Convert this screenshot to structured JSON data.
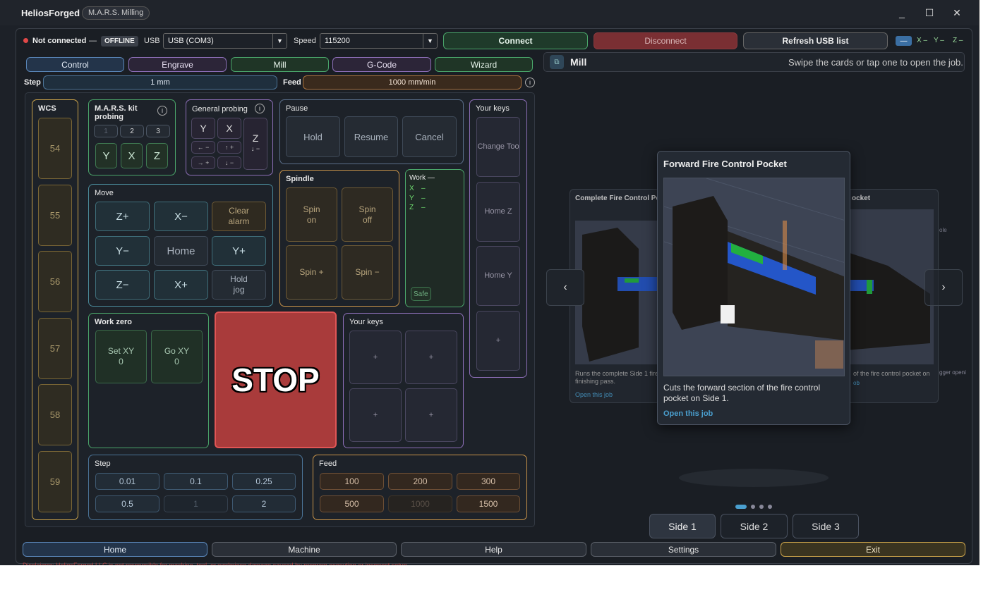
{
  "window": {
    "title": "HeliosForged",
    "badge": "M.A.R.S. Milling",
    "minimize": "_",
    "maximize": "☐",
    "close": "✕"
  },
  "connection": {
    "status": "Not connected",
    "dash": "—",
    "badge": "OFFLINE",
    "usb_label": "USB",
    "usb_value": "USB (COM3)",
    "speed_label": "Speed",
    "speed_value": "115200",
    "connect": "Connect",
    "disconnect": "Disconnect",
    "refresh": "Refresh USB list",
    "mini_btn": "—",
    "x": "X –",
    "y": "Y –",
    "z": "Z –"
  },
  "tabs": [
    "Control",
    "Engrave",
    "Mill",
    "G-Code",
    "Wizard"
  ],
  "step_bar": {
    "label": "Step",
    "value": "1 mm",
    "feed_label": "Feed",
    "feed_value": "1000 mm/min",
    "info": "i"
  },
  "wcs": {
    "title": "WCS",
    "items": [
      "54",
      "55",
      "56",
      "57",
      "58",
      "59"
    ]
  },
  "mars": {
    "title": "M.A.R.S. kit probing",
    "info": "i",
    "nums": [
      "1",
      "2",
      "3"
    ],
    "axes": [
      "Y",
      "X",
      "Z"
    ]
  },
  "general_probing": {
    "title": "General probing",
    "info": "i",
    "y": "Y",
    "x": "X",
    "z": "Z",
    "z_sub": "↓ −",
    "a1": "← −",
    "a2": "↑ +",
    "a3": "→ +",
    "a4": "↓ −"
  },
  "pause": {
    "title": "Pause",
    "hold": "Hold",
    "resume": "Resume",
    "cancel": "Cancel"
  },
  "your_keys_right": {
    "title": "Your keys",
    "items": [
      "Change Too",
      "Home Z",
      "Home Y",
      "+"
    ]
  },
  "move": {
    "title": "Move",
    "keys": [
      "Z+",
      "X−",
      "Clear alarm",
      "Y−",
      "Home",
      "Y+",
      "Z−",
      "X+",
      "Hold jog"
    ]
  },
  "spindle": {
    "title": "Spindle",
    "keys": [
      "Spin on",
      "Spin off",
      "Spin +",
      "Spin −"
    ]
  },
  "work": {
    "title": "Work —",
    "x": "X",
    "y": "Y",
    "z": "Z",
    "xv": "–",
    "yv": "–",
    "zv": "–",
    "safe": "Safe"
  },
  "work_zero": {
    "title": "Work zero",
    "set": "Set XY 0",
    "go": "Go XY 0"
  },
  "stop": "STOP",
  "your_keys_mid": {
    "title": "Your keys",
    "items": [
      "+",
      "+",
      "+",
      "+"
    ]
  },
  "step": {
    "title": "Step",
    "items": [
      "0.01",
      "0.1",
      "0.25",
      "0.5",
      "1",
      "2"
    ]
  },
  "feed": {
    "title": "Feed",
    "items": [
      "100",
      "200",
      "300",
      "500",
      "1000",
      "1500"
    ]
  },
  "mill": {
    "title": "Mill",
    "hint": "Swipe the cards or tap one to open the job.",
    "prev": "‹",
    "next": "›",
    "center": {
      "title": "Forward Fire Control Pocket",
      "desc": "Cuts the forward section of the fire control pocket on Side 1.",
      "link": "Open this job"
    },
    "left": {
      "title": "Complete Fire Control Poc",
      "desc": "Runs the complete Side 1 fire finishing pass.",
      "link": "Open this job"
    },
    "right": {
      "title": "ocket",
      "desc": "of the fire control pocket on",
      "link": "ob",
      "extra": "ole",
      "extra2": "gger openi"
    },
    "sides": [
      "Side 1",
      "Side 2",
      "Side 3"
    ]
  },
  "footer": [
    "Home",
    "Machine",
    "Help",
    "Settings",
    "Exit"
  ],
  "disclaimer": "Disclaimer: HeliosForged LLC is not responsible for machine, tool, or workpiece damage caused by program execution or incorrect setup."
}
